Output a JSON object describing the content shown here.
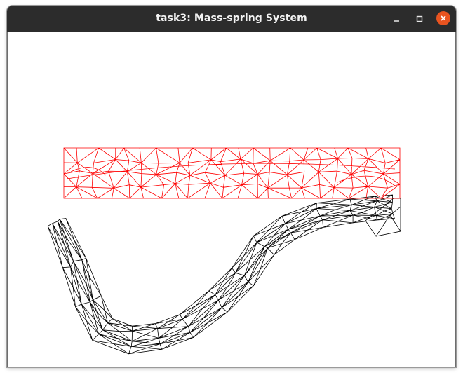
{
  "window": {
    "title": "task3: Mass-spring System",
    "controls": {
      "minimize_icon": "minimize-icon",
      "maximize_icon": "maximize-icon",
      "close_icon": "close-icon"
    }
  },
  "colors": {
    "titlebar": "#2c2c2c",
    "close_button": "#e95420",
    "rest_mesh": "#ff0000",
    "deformed_mesh": "#000000",
    "canvas_background": "#ffffff"
  }
}
